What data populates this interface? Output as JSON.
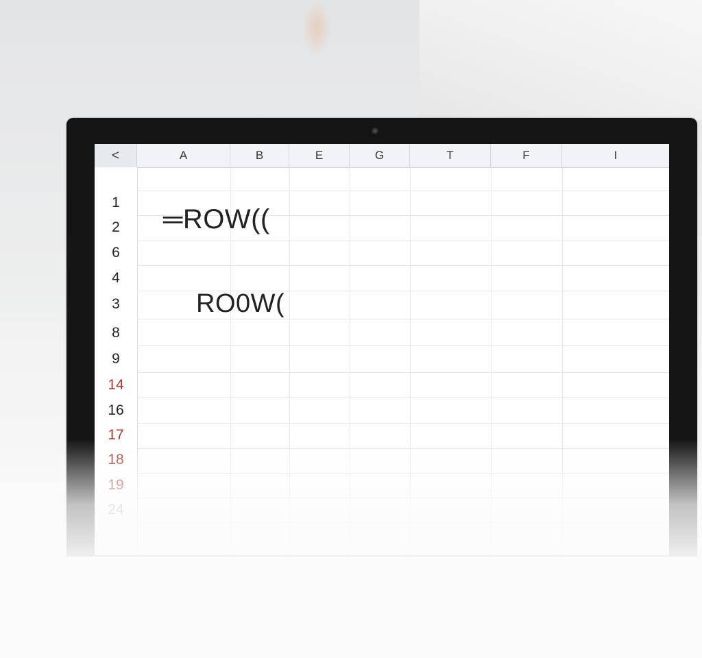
{
  "spreadsheet": {
    "back_glyph": "<",
    "columns": [
      "A",
      "B",
      "E",
      "G",
      "T",
      "F",
      "I"
    ],
    "rows": [
      {
        "label": "1",
        "color": "#222222"
      },
      {
        "label": "2",
        "color": "#222222"
      },
      {
        "label": "6",
        "color": "#222222"
      },
      {
        "label": "4",
        "color": "#222222"
      },
      {
        "label": "3",
        "color": "#222222"
      },
      {
        "label": "8",
        "color": "#222222"
      },
      {
        "label": "9",
        "color": "#222222"
      },
      {
        "label": "14",
        "color": "#b3362b"
      },
      {
        "label": "16",
        "color": "#222222"
      },
      {
        "label": "17",
        "color": "#b3362b"
      },
      {
        "label": "18",
        "color": "#b3362b"
      },
      {
        "label": "19",
        "color": "#c0463a"
      },
      {
        "label": "24",
        "color": "#999999"
      }
    ],
    "cells": {
      "formula_1": "═ROW((",
      "formula_2": "RO0W("
    }
  },
  "colors": {
    "bezel": "#141414",
    "header_bg": "#f1f3f6",
    "grid_line": "#e3e6ea"
  }
}
